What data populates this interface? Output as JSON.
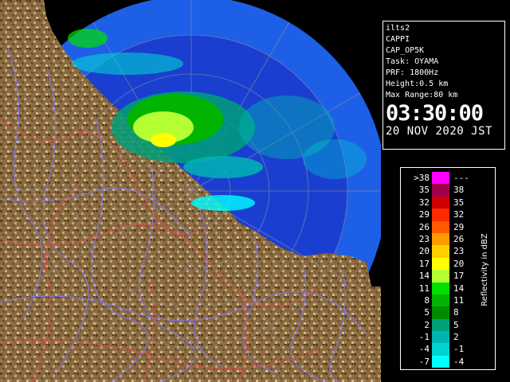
{
  "info": {
    "product_id": "ilts2",
    "product_type": "CAPPI",
    "product_name": "CAP_OP5K",
    "task": "Task: OYAMA",
    "prf": "PRF: 1800Hz",
    "height": "Height:0.5 km",
    "max_range": "Max Range:80 km",
    "time": "03:30:00",
    "date": "20 NOV 2020 JST"
  },
  "legend": {
    "axis_label": "Reflectivity in dBZ",
    "rows": [
      {
        "left": ">38",
        "right": "---",
        "color": "#ff00ff"
      },
      {
        "left": "35",
        "right": "38",
        "color": "#a0004c"
      },
      {
        "left": "32",
        "right": "35",
        "color": "#d00000"
      },
      {
        "left": "29",
        "right": "32",
        "color": "#ff2a00"
      },
      {
        "left": "26",
        "right": "29",
        "color": "#ff5a00"
      },
      {
        "left": "23",
        "right": "26",
        "color": "#ff9a00"
      },
      {
        "left": "20",
        "right": "23",
        "color": "#ffd000"
      },
      {
        "left": "17",
        "right": "20",
        "color": "#ffff00"
      },
      {
        "left": "14",
        "right": "17",
        "color": "#b4ff32"
      },
      {
        "left": "11",
        "right": "14",
        "color": "#00e000"
      },
      {
        "left": "8",
        "right": "11",
        "color": "#00b400"
      },
      {
        "left": "5",
        "right": "8",
        "color": "#008c00"
      },
      {
        "left": "2",
        "right": "5",
        "color": "#00a07a"
      },
      {
        "left": "-1",
        "right": "2",
        "color": "#00b4b4"
      },
      {
        "left": "-4",
        "right": "-1",
        "color": "#00d2d2"
      },
      {
        "left": "-7",
        "right": "-4",
        "color": "#00ffff"
      }
    ]
  },
  "colors": {
    "sea": "#1e5fe8",
    "sea_deep": "#1a3fd0",
    "coverage_edge": "#000000",
    "land": "#8a6a3e",
    "land_dark": "#5a4222",
    "land_light": "#bfa57a",
    "rivers": "#7e79ff",
    "borders": "#e05050"
  }
}
